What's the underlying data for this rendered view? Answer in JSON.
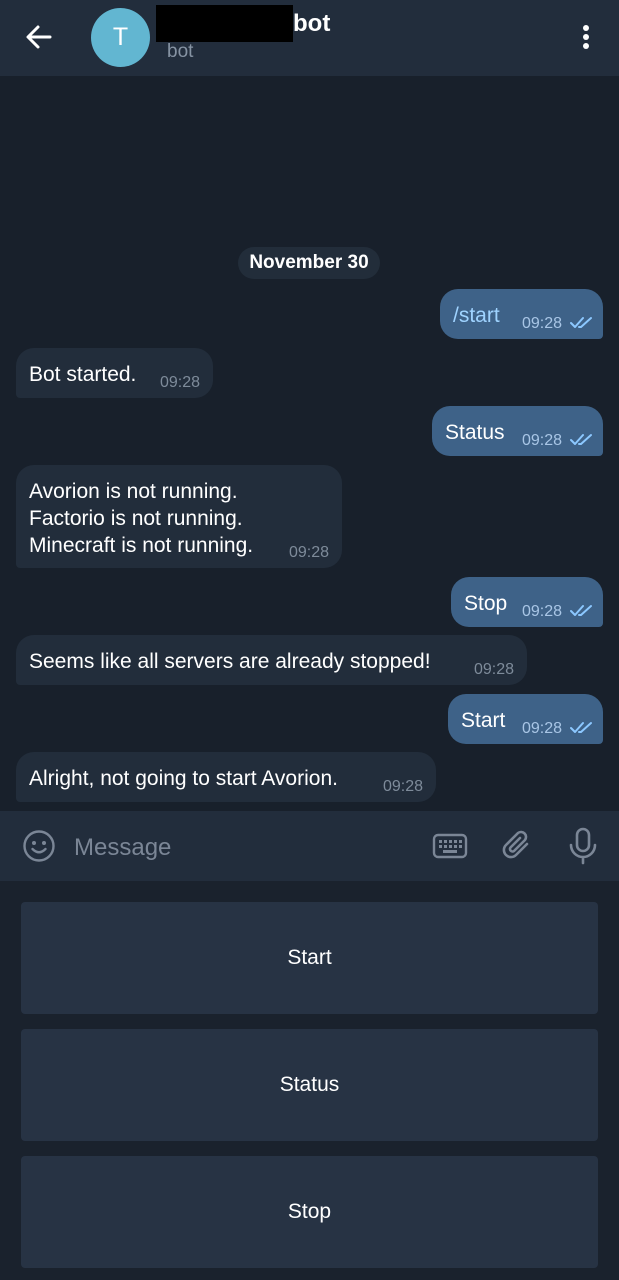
{
  "header": {
    "avatar_letter": "T",
    "title": "bot",
    "subtitle": "bot"
  },
  "chat": {
    "date": "November 30",
    "messages": [
      {
        "direction": "out",
        "text": "/start",
        "time": "09:28",
        "status": "read"
      },
      {
        "direction": "in",
        "text": "Bot started.",
        "time": "09:28"
      },
      {
        "direction": "out",
        "text": "Status",
        "time": "09:28",
        "status": "read"
      },
      {
        "direction": "in",
        "text": "Avorion is not running.\nFactorio is not running.\nMinecraft is not running.",
        "time": "09:28"
      },
      {
        "direction": "out",
        "text": "Stop",
        "time": "09:28",
        "status": "read"
      },
      {
        "direction": "in",
        "text": "Seems like all servers are already stopped!",
        "time": "09:28"
      },
      {
        "direction": "out",
        "text": "Start",
        "time": "09:28",
        "status": "read"
      },
      {
        "direction": "in",
        "text": "Alright, not going to start Avorion.",
        "time": "09:28"
      }
    ]
  },
  "composer": {
    "placeholder": "Message"
  },
  "keyboard": {
    "buttons": [
      "Start",
      "Status",
      "Stop"
    ]
  },
  "colors": {
    "background": "#18202b",
    "header": "#222d3c",
    "incoming_bubble": "#222d3b",
    "outgoing_bubble": "#3e6288",
    "read_tick": "#8cc8ff",
    "avatar": "#62b6d1",
    "keyboard_button": "#273344"
  },
  "icons": [
    "back-arrow-icon",
    "more-vertical-icon",
    "emoji-icon",
    "keyboard-icon",
    "paperclip-icon",
    "microphone-icon",
    "double-check-icon"
  ]
}
